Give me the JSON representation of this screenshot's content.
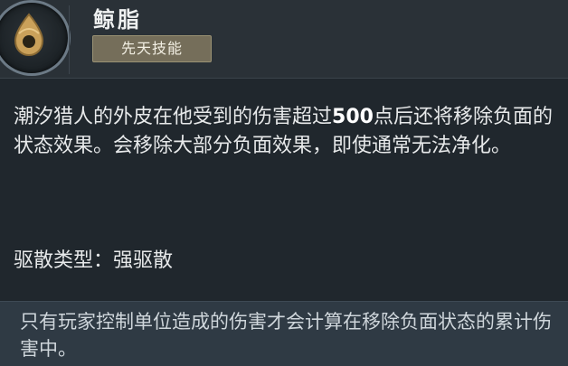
{
  "ability": {
    "name": "鲸脂",
    "tag": "先天技能",
    "icon": "fat-drop-icon"
  },
  "description": {
    "before": "潮汐猎人的外皮在他受到的伤害超过",
    "number": "500",
    "after": "点后还将移除负面的状态效果。会移除大部分负面效果，即使通常无法净化。"
  },
  "dispel_type": "驱散类型：强驱散",
  "footer_note": "只有玩家控制单位造成的伤害才会计算在移除负面状态的累计伤害中。",
  "colors": {
    "tag_bg": "#756e5a",
    "footer_bg": "#2f3a44",
    "panel_bg": "#20272d"
  }
}
